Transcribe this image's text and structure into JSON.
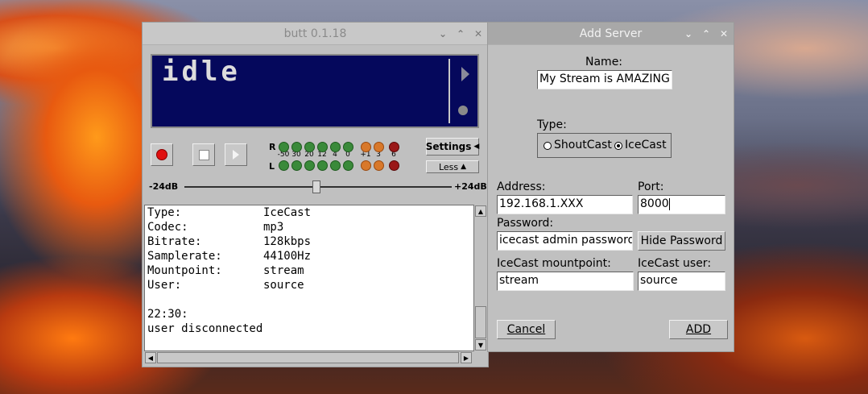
{
  "butt": {
    "title": "butt 0.1.18",
    "display_text": "idle",
    "settings_label": "Settings",
    "less_label": "Less",
    "vu": {
      "right_label": "R",
      "left_label": "L",
      "ticks": [
        "-50",
        "30",
        "20",
        "12",
        "4",
        "0",
        "+1",
        "3",
        "6"
      ]
    },
    "gain_min": "-24dB",
    "gain_max": "+24dB",
    "info": [
      {
        "key": "Type:",
        "value": "IceCast"
      },
      {
        "key": "Codec:",
        "value": "mp3"
      },
      {
        "key": "Bitrate:",
        "value": "128kbps"
      },
      {
        "key": "Samplerate:",
        "value": "44100Hz"
      },
      {
        "key": "Mountpoint:",
        "value": "stream"
      },
      {
        "key": "User:",
        "value": "source"
      }
    ],
    "log_time": "22:30:",
    "log_message": "user disconnected"
  },
  "add_server": {
    "title": "Add Server",
    "name_label": "Name:",
    "name_value": "My Stream is AMAZING",
    "type_label": "Type:",
    "type_shoutcast": "ShoutCast",
    "type_icecast": "IceCast",
    "selected_type": "IceCast",
    "address_label": "Address:",
    "address_value": "192.168.1.XXX",
    "port_label": "Port:",
    "port_value": "8000",
    "password_label": "Password:",
    "password_value": "icecast admin password",
    "hide_password_label": "Hide Password",
    "mountpoint_label": "IceCast mountpoint:",
    "mountpoint_value": "stream",
    "user_label": "IceCast user:",
    "user_value": "source",
    "cancel_label": "Cancel",
    "add_label": "ADD"
  }
}
